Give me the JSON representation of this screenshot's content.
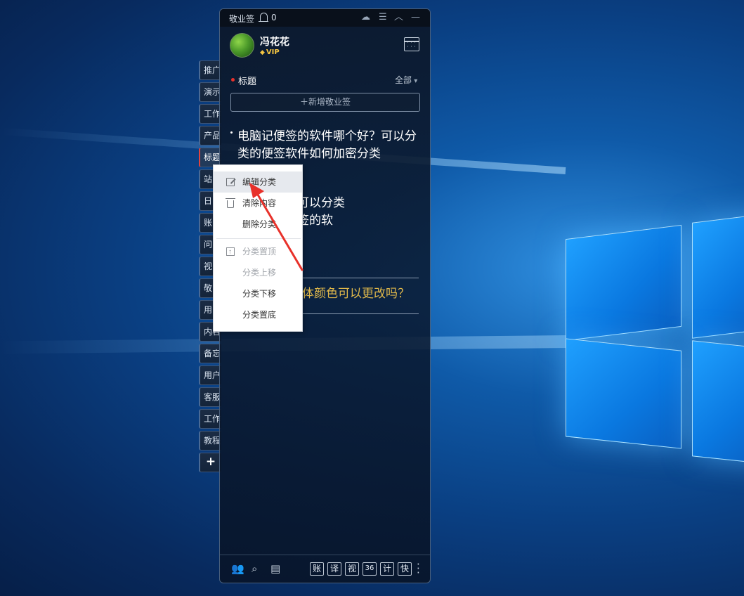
{
  "app": {
    "name": "敬业签",
    "notification_count": "0",
    "user": {
      "name": "冯花花",
      "badge": "VIP"
    },
    "category_title": "标题",
    "filter_label": "全部",
    "new_note_label": "＋新增敬业签",
    "notes": [
      {
        "text": "电脑记便签的软件哪个好？可以分类的便签软件如何加密分类"
      },
      {
        "text": "件哪个好、可以分类\n、电脑记便签的软"
      },
      {
        "text": "体颜色可以更改吗？"
      }
    ],
    "quick_tools": [
      "账",
      "译",
      "视",
      "36",
      "计",
      "快"
    ]
  },
  "side_tabs": [
    "推广",
    "演示",
    "工作",
    "产品",
    "标题",
    "站",
    "日",
    "账",
    "问",
    "视",
    "敬",
    "用",
    "内容",
    "备忘",
    "用户",
    "客服",
    "工作",
    "教程"
  ],
  "side_tab_add": "+",
  "context_menu": {
    "items": [
      {
        "label": "编辑分类",
        "icon": "edit-icon",
        "highlighted": true,
        "disabled": false
      },
      {
        "label": "清除内容",
        "icon": "trash-icon",
        "highlighted": false,
        "disabled": false
      },
      {
        "label": "删除分类",
        "icon": "",
        "highlighted": false,
        "disabled": false
      },
      {
        "label": "分类置顶",
        "icon": "pin-top-icon",
        "highlighted": false,
        "disabled": true
      },
      {
        "label": "分类上移",
        "icon": "",
        "highlighted": false,
        "disabled": true
      },
      {
        "label": "分类下移",
        "icon": "",
        "highlighted": false,
        "disabled": false
      },
      {
        "label": "分类置底",
        "icon": "",
        "highlighted": false,
        "disabled": false
      }
    ]
  },
  "colors": {
    "accent_red": "#e6322c",
    "vip_gold": "#f5c542",
    "note_highlight": "#e0b84a",
    "annotation_arrow": "#e8312a"
  }
}
